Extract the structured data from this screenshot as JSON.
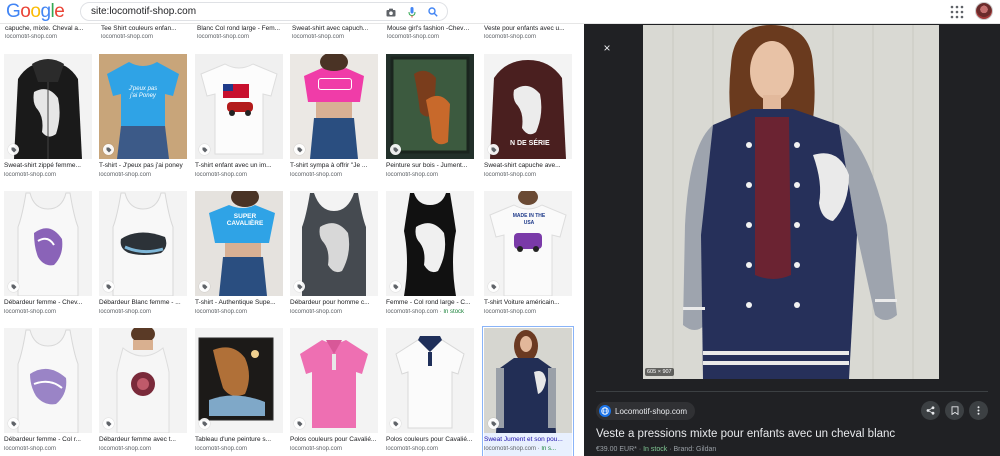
{
  "header": {
    "logo": [
      {
        "ch": "G",
        "color": "#4285f4"
      },
      {
        "ch": "o",
        "color": "#ea4335"
      },
      {
        "ch": "o",
        "color": "#fbbc05"
      },
      {
        "ch": "g",
        "color": "#4285f4"
      },
      {
        "ch": "l",
        "color": "#34a853"
      },
      {
        "ch": "e",
        "color": "#ea4335"
      }
    ],
    "search_value": "site:locomotif-shop.com"
  },
  "top_captions": [
    "capuche, mixte. Cheval a...",
    "Tee Shirt couleurs enfan...",
    "Blanc Col rond large - Fem...",
    "Sweat-shirt avec capuch...",
    "Mouse girl's fashion -Cheva...",
    "Veste pour enfants avec u..."
  ],
  "top_source": "locomotif-shop.com",
  "results": [
    {
      "title": "Sweat-shirt zippé femme...",
      "source": "locomotif-shop.com"
    },
    {
      "title": "T-shirt - J'peux pas j'ai poney",
      "source": "locomotif-shop.com"
    },
    {
      "title": "T-shirt enfant avec un im...",
      "source": "locomotif-shop.com"
    },
    {
      "title": "T-shirt sympa à offrir \"Je ...",
      "source": "locomotif-shop.com"
    },
    {
      "title": "Peinture sur bois - Jument...",
      "source": "locomotif-shop.com"
    },
    {
      "title": "Sweat-shirt capuche ave...",
      "source": "locomotif-shop.com"
    },
    {
      "title": "Débardeur femme - Chev...",
      "source": "locomotif-shop.com"
    },
    {
      "title": "Débardeur Blanc femme - ...",
      "source": "locomotif-shop.com"
    },
    {
      "title": "T-shirt - Authentique Supe...",
      "source": "locomotif-shop.com"
    },
    {
      "title": "Débardeur pour homme c...",
      "source": "locomotif-shop.com"
    },
    {
      "title": "Femme - Col rond large - C...",
      "source": "locomotif-shop.com",
      "stock": "In stock"
    },
    {
      "title": "T-shirt Voiture américain...",
      "source": "locomotif-shop.com"
    },
    {
      "title": "Débardeur femme - Col r...",
      "source": "locomotif-shop.com"
    },
    {
      "title": "Débardeur femme avec t...",
      "source": "locomotif-shop.com"
    },
    {
      "title": "Tableau d'une peinture s...",
      "source": "locomotif-shop.com"
    },
    {
      "title": "Polos couleurs pour Cavalié...",
      "source": "locomotif-shop.com"
    },
    {
      "title": "Polos couleurs pour Cavalié...",
      "source": "locomotif-shop.com"
    },
    {
      "title": "Sweat Jument et son pou...",
      "source": "locomotif-shop.com",
      "stock": "In s..."
    }
  ],
  "thumb_text": {
    "poney": "J'peux pas\nj'ai Poney",
    "super": "SUPER\nCAVALIÈRE",
    "usa": "MADE IN THE\nUSA",
    "serie": "N DE SÉRIE"
  },
  "panel": {
    "close_label": "×",
    "dims": "605 × 907",
    "site": "Locomotif-shop.com",
    "title": "Veste a pressions mixte pour enfants avec un cheval blanc",
    "price": "€39.00 EUR*",
    "sep": "·",
    "stock": "In stock",
    "brand": "Brand: Gildan"
  },
  "colors": {
    "accent": "#1a73e8",
    "panel_bg": "#202124",
    "stock_green": "#188038"
  }
}
